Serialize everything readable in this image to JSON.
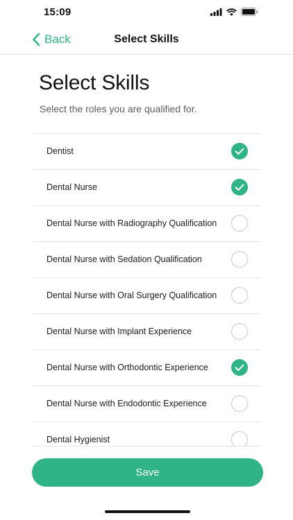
{
  "status_bar": {
    "time": "15:09"
  },
  "nav": {
    "back_label": "Back",
    "title": "Select Skills"
  },
  "header": {
    "title": "Select Skills",
    "subtitle": "Select the roles you are qualified for."
  },
  "skills": [
    {
      "label": "Dentist",
      "checked": true
    },
    {
      "label": "Dental Nurse",
      "checked": true
    },
    {
      "label": "Dental Nurse with Radiography Qualification",
      "checked": false
    },
    {
      "label": "Dental Nurse with Sedation Qualification",
      "checked": false
    },
    {
      "label": "Dental Nurse with Oral Surgery Qualification",
      "checked": false
    },
    {
      "label": "Dental Nurse with Implant Experience",
      "checked": false
    },
    {
      "label": "Dental Nurse with Orthodontic Experience",
      "checked": true
    },
    {
      "label": "Dental Nurse with Endodontic Experience",
      "checked": false
    },
    {
      "label": "Dental Hygienist",
      "checked": false
    }
  ],
  "save_label": "Save",
  "colors": {
    "accent": "#2fb487"
  },
  "icons": {
    "back": "chevron-left-icon",
    "checked": "checkmark-icon",
    "signal": "cellular-signal-icon",
    "wifi": "wifi-icon",
    "battery": "battery-icon"
  }
}
